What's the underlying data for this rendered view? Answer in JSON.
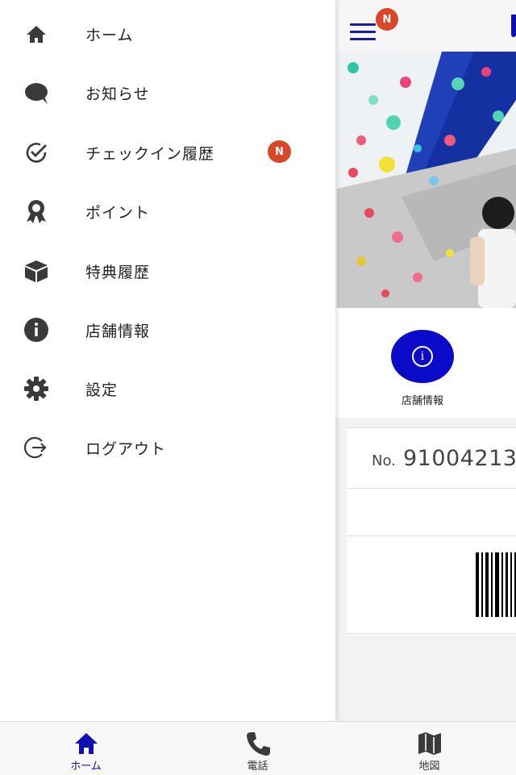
{
  "header": {
    "menu_badge": "N"
  },
  "drawer": {
    "items": [
      {
        "label": "ホーム",
        "icon": "home-icon"
      },
      {
        "label": "お知らせ",
        "icon": "chat-bubble-icon"
      },
      {
        "label": "チェックイン履歴",
        "icon": "check-circle-icon",
        "badge": "N"
      },
      {
        "label": "ポイント",
        "icon": "award-ribbon-icon"
      },
      {
        "label": "特典履歴",
        "icon": "box-icon"
      },
      {
        "label": "店舗情報",
        "icon": "info-icon"
      },
      {
        "label": "設定",
        "icon": "gear-icon"
      },
      {
        "label": "ログアウト",
        "icon": "logout-icon"
      }
    ]
  },
  "main": {
    "shop_info_label": "店舗情報",
    "member": {
      "no_label": "No.",
      "no_value": "91004213"
    }
  },
  "tabbar": {
    "tabs": [
      {
        "label": "ホーム",
        "icon": "home-icon",
        "active": true
      },
      {
        "label": "電話",
        "icon": "phone-icon",
        "active": false
      },
      {
        "label": "地図",
        "icon": "map-icon",
        "active": false
      }
    ]
  },
  "colors": {
    "accent": "#1010b0",
    "badge": "#d9472b",
    "icon_gray": "#3a3a3a"
  }
}
